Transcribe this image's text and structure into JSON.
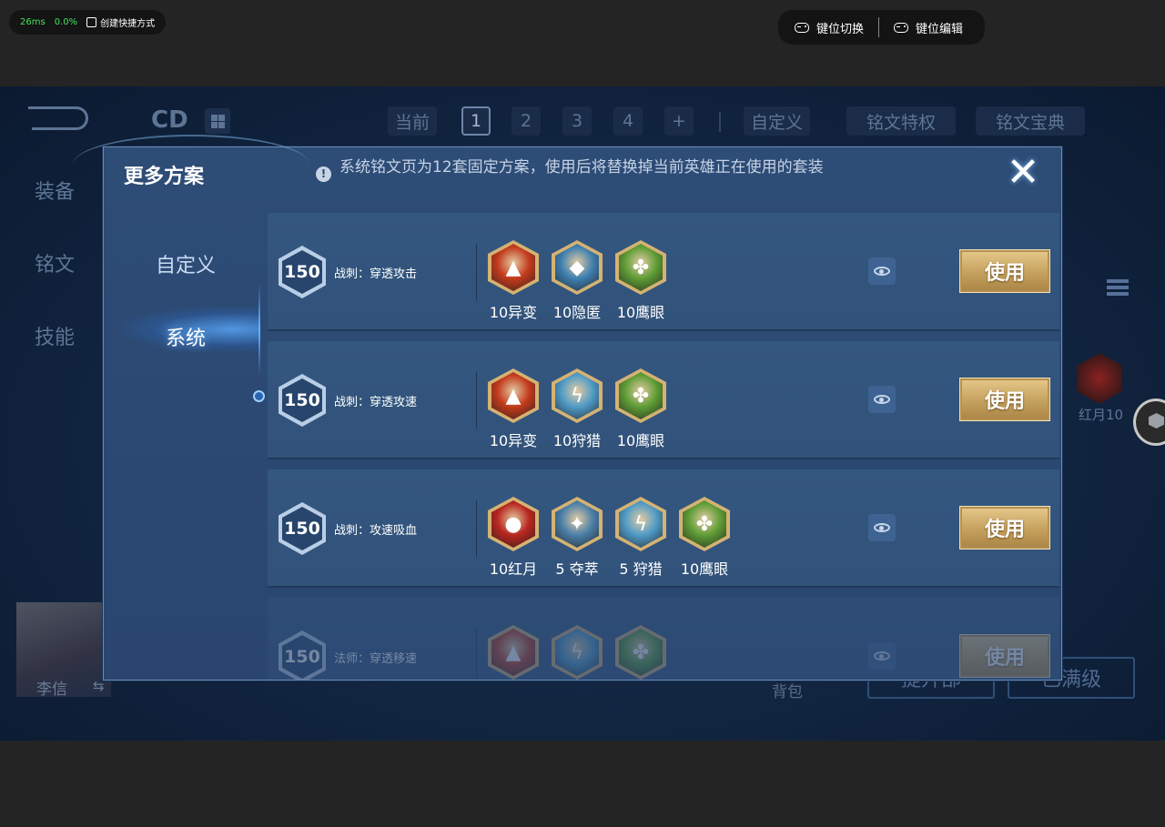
{
  "emulator": {
    "ping": "26ms",
    "loss": "0.0%",
    "shortcut_label": "创建快捷方式",
    "key_switch_label": "键位切换",
    "key_edit_label": "键位编辑"
  },
  "background": {
    "cd_label": "CD",
    "current_label": "当前",
    "pages": [
      "1",
      "2",
      "3",
      "4",
      "+"
    ],
    "active_page": "1",
    "custom_label": "自定义",
    "perk_label": "铭文特权",
    "codex_label": "铭文宝典",
    "left_tabs": [
      "装备",
      "铭文",
      "技能"
    ],
    "right_badge_label": "红月10",
    "hero_name": "李信",
    "swap_glyph": "⇆",
    "bag_label": "背包",
    "btn_upgrade": "提升部",
    "btn_maxed": "已满级"
  },
  "dialog": {
    "title": "更多方案",
    "info_glyph": "!",
    "note": "系统铭文页为12套固定方案，使用后将替换掉当前英雄正在使用的套装",
    "close_glyph": "✕",
    "tabs": [
      "自定义",
      "系统"
    ],
    "active_tab": "系统",
    "rows": [
      {
        "level": "150",
        "name": "战刺：穿透攻击",
        "runes": [
          {
            "label": "10异变",
            "color": "#c23a1c",
            "icon": "mutation-icon"
          },
          {
            "label": "10隐匿",
            "color": "#3e7fb0",
            "icon": "stealth-icon"
          },
          {
            "label": "10鹰眼",
            "color": "#5e9c35",
            "icon": "hawkeye-icon"
          }
        ],
        "use_label": "使用"
      },
      {
        "level": "150",
        "name": "战刺：穿透攻速",
        "runes": [
          {
            "label": "10异变",
            "color": "#c23a1c",
            "icon": "mutation-icon"
          },
          {
            "label": "10狩猎",
            "color": "#4f9bc7",
            "icon": "hunt-icon"
          },
          {
            "label": "10鹰眼",
            "color": "#5e9c35",
            "icon": "hawkeye-icon"
          }
        ],
        "use_label": "使用"
      },
      {
        "level": "150",
        "name": "战刺：攻速吸血",
        "runes": [
          {
            "label": "10红月",
            "color": "#b8261e",
            "icon": "red-moon-icon"
          },
          {
            "label": "5 夺萃",
            "color": "#4a7fa8",
            "icon": "plunder-icon"
          },
          {
            "label": "5 狩猎",
            "color": "#4f9bc7",
            "icon": "hunt-icon"
          },
          {
            "label": "10鹰眼",
            "color": "#5e9c35",
            "icon": "hawkeye-icon"
          }
        ],
        "use_label": "使用"
      },
      {
        "level": "150",
        "name": "法师：穿透移速",
        "runes": [
          {
            "label": "",
            "color": "#c23a1c",
            "icon": "mutation-icon"
          },
          {
            "label": "",
            "color": "#4f9bc7",
            "icon": "hunt-icon"
          },
          {
            "label": "",
            "color": "#5e9c35",
            "icon": "hawkeye-icon"
          }
        ],
        "use_label": "使用"
      }
    ]
  }
}
